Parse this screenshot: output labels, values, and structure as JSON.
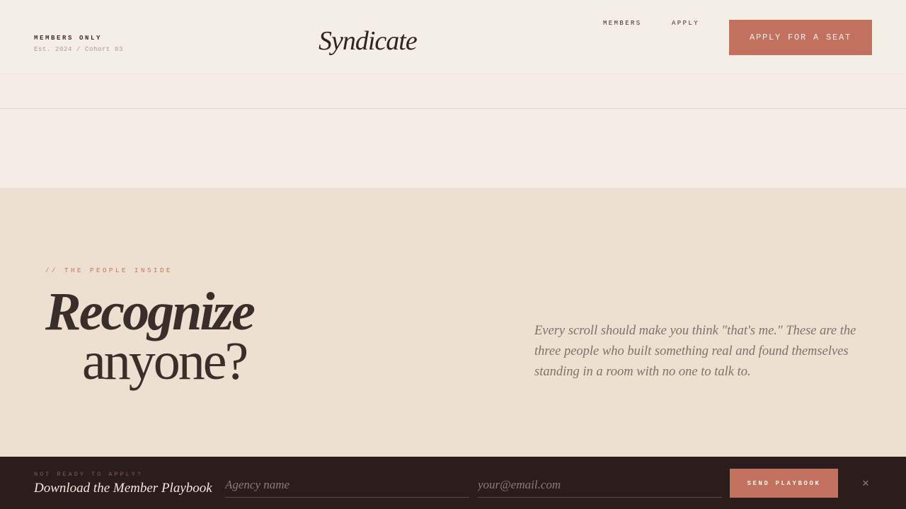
{
  "header": {
    "members_only": "MEMBERS ONLY",
    "est": "Est. 2024 / Cohort 03",
    "logo": "Syndicate",
    "nav": [
      {
        "label": "MEMBERS"
      },
      {
        "label": "APPLY"
      }
    ],
    "cta_label": "APPLY FOR A SEAT"
  },
  "section": {
    "eyebrow": "// THE PEOPLE INSIDE",
    "headline_line1": "Recognize",
    "headline_line2": "anyone?",
    "lede": "Every scroll should make you think \"that's me.\" These are the three people who built something real and found themselves standing in a room with no one to talk to."
  },
  "footer": {
    "eyebrow": "NOT READY TO APPLY?",
    "title": "Download the Member Playbook",
    "agency_placeholder": "Agency name",
    "email_placeholder": "your@email.com",
    "send_label": "SEND PLAYBOOK",
    "close_icon": "close-icon"
  },
  "colors": {
    "accent": "#c4705e",
    "footer_bg": "#2a1e1d",
    "section_bg": "#ede0d0",
    "page_bg": "#f4ece5"
  }
}
